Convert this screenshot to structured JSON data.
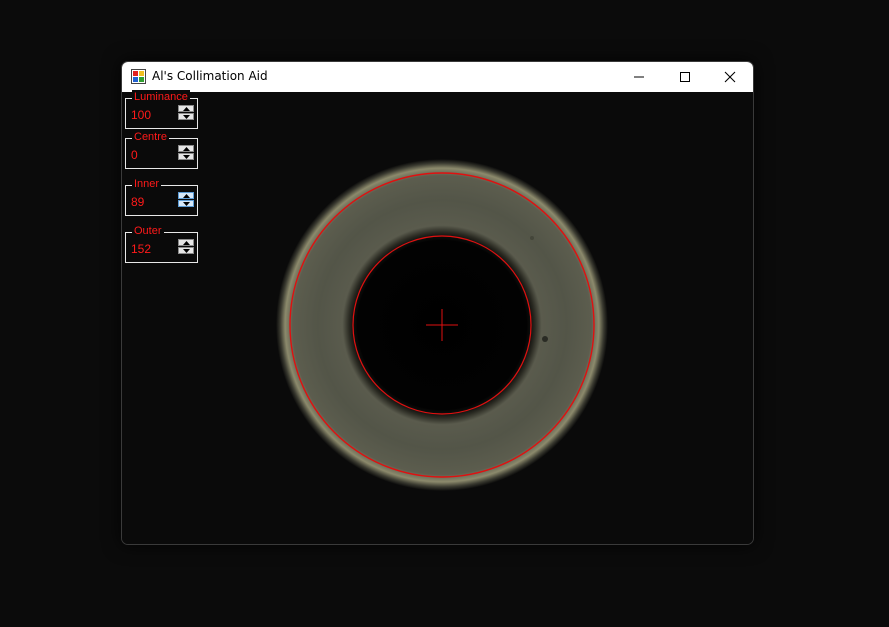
{
  "window": {
    "title": "Al's Collimation Aid",
    "app_icon": "colorful-app-icon",
    "controls": {
      "minimize": "minimize-icon",
      "maximize": "maximize-icon",
      "close": "close-icon"
    }
  },
  "settings": [
    {
      "label": "Luminance",
      "value": "100"
    },
    {
      "label": "Centre",
      "value": "0"
    },
    {
      "label": "Inner",
      "value": "89"
    },
    {
      "label": "Outer",
      "value": "152"
    }
  ],
  "overlay": {
    "color": "#e01010",
    "inner_radius": 89,
    "outer_radius": 152,
    "crosshair": "crosshair-icon"
  },
  "colors": {
    "annulus": "#55574a",
    "halo": "#8e8c6e",
    "titlebar": "#ffffff",
    "label": "#ff1a1a"
  }
}
